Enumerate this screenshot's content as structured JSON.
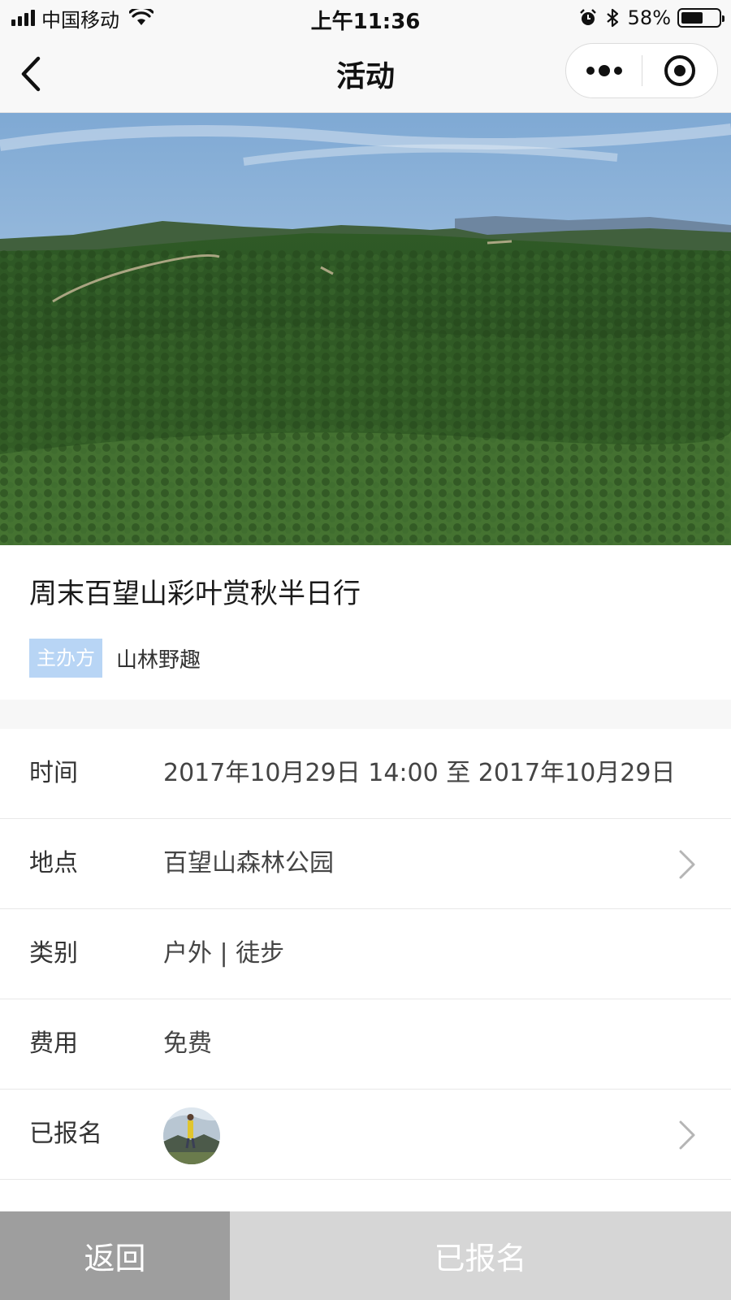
{
  "status_bar": {
    "carrier": "中国移动",
    "time": "上午11:36",
    "battery_percent": "58%",
    "battery_level": 0.58
  },
  "nav": {
    "title": "活动",
    "icons": [
      "back-chevron-icon",
      "more-dots-icon",
      "close-target-icon"
    ]
  },
  "event": {
    "title": "周末百望山彩叶赏秋半日行",
    "organizer_tag": "主办方",
    "organizer_name": "山林野趣"
  },
  "details": [
    {
      "label": "时间",
      "value": "2017年10月29日 14:00 至 2017年10月29日"
    },
    {
      "label": "地点",
      "value": "百望山森林公园"
    },
    {
      "label": "类别",
      "value": "户外 | 徒步"
    },
    {
      "label": "费用",
      "value": "免费"
    },
    {
      "label": "已报名",
      "value": ""
    }
  ],
  "footer": {
    "back_label": "返回",
    "joined_label": "已报名"
  },
  "colors": {
    "organizer_tag_bg": "#b8d5f5",
    "back_button_bg": "#9e9e9e",
    "joined_button_bg": "#d6d6d6"
  }
}
